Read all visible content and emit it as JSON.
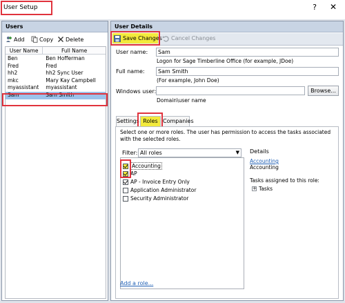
{
  "window": {
    "title": "User Setup",
    "help": "?",
    "close": "✕"
  },
  "users_panel": {
    "title": "Users",
    "toolbar": {
      "add": "Add",
      "copy": "Copy",
      "delete": "Delete"
    },
    "columns": [
      "User Name",
      "Full Name"
    ],
    "rows": [
      {
        "user": "Ben",
        "full": "Ben Hofferman"
      },
      {
        "user": "Fred",
        "full": "Fred"
      },
      {
        "user": "hh2",
        "full": "hh2 Sync User"
      },
      {
        "user": "mkc",
        "full": "Mary Kay Campbell"
      },
      {
        "user": "myassistant",
        "full": "myassistant"
      },
      {
        "user": "Sam",
        "full": "Sam Smith",
        "selected": true
      }
    ]
  },
  "details_panel": {
    "title": "User Details",
    "toolbar": {
      "save": "Save Changes",
      "cancel": "Cancel Changes"
    },
    "user_name": {
      "label": "User name:",
      "value": "Sam",
      "hint": "Logon for Sage Timberline Office (for example, JDoe)"
    },
    "full_name": {
      "label": "Full name:",
      "value": "Sam Smith",
      "hint": "(For example, John Doe)"
    },
    "windows_user": {
      "label": "Windows user:",
      "value": "",
      "hint": "Domain\\user name",
      "browse": "Browse..."
    },
    "tabs": [
      "Settings",
      "Roles",
      "Companies"
    ],
    "active_tab": "Roles",
    "roles_description": "Select one or more roles. The user has permission to access the tasks associated with the selected roles.",
    "filter": {
      "label": "Filter:",
      "value": "All roles"
    },
    "roles": [
      {
        "name": "Accounting",
        "checked": true
      },
      {
        "name": "AP",
        "checked": true
      },
      {
        "name": "AP - Invoice Entry Only",
        "checked": true
      },
      {
        "name": "Application Administrator",
        "checked": false
      },
      {
        "name": "Security Administrator",
        "checked": false
      }
    ],
    "details": {
      "heading": "Details",
      "role_link": "Accounting",
      "role_name": "Accounting",
      "tasks_heading": "Tasks assigned to this role:",
      "tasks_node": "Tasks"
    },
    "add_role": "Add a role..."
  },
  "colors": {
    "highlight_box": "#e0323c",
    "highlight_fill": "#f3ea3c",
    "selected_row": "#9cc2ea",
    "panel_header": "#c8d4e4",
    "link": "#1f5fb4"
  }
}
